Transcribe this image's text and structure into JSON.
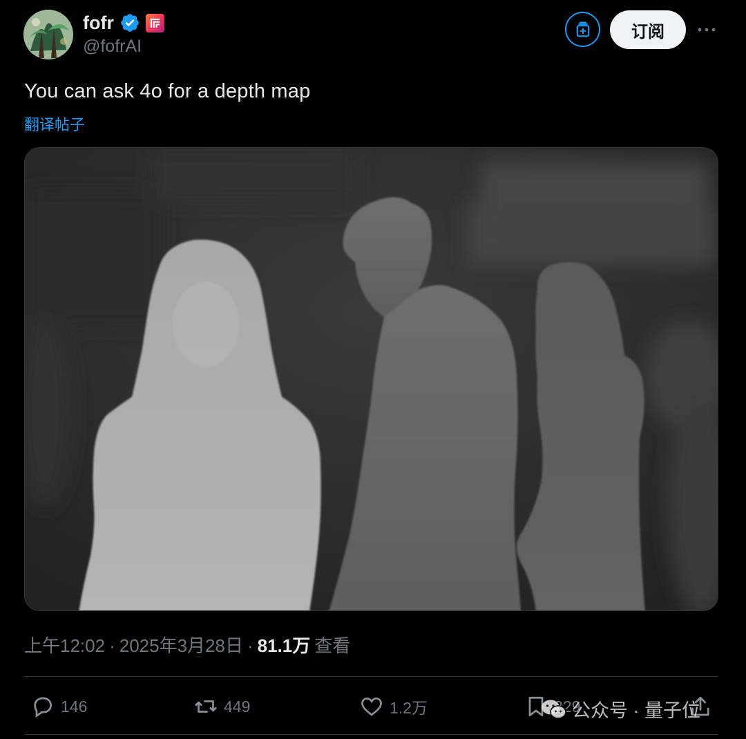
{
  "author": {
    "display_name": "fofr",
    "handle": "@fofrAI",
    "avatar_icon": "avatar-image",
    "verified_icon": "verified-badge-icon",
    "affiliate_icon": "replicate-logo-icon"
  },
  "header": {
    "subscribe_label": "订阅",
    "subscribe_icon": "subscribe-icon",
    "more_icon": "more-icon"
  },
  "tweet": {
    "text": "You can ask 4o for a depth map",
    "translate_label": "翻译帖子",
    "media_icon": "depth-map-image"
  },
  "meta": {
    "time": "上午12:02",
    "date": "2025年3月28日",
    "separator": "·",
    "views_count": "81.1万",
    "views_label": "查看"
  },
  "actions": {
    "replies": "146",
    "reposts": "449",
    "likes": "1.2万",
    "bookmarks": "229"
  },
  "watermark": {
    "text": "公众号 · 量子位"
  },
  "colors": {
    "background": "#000000",
    "text_primary": "#e7e9ea",
    "text_secondary": "#71767b",
    "accent": "#1d9bf0"
  }
}
